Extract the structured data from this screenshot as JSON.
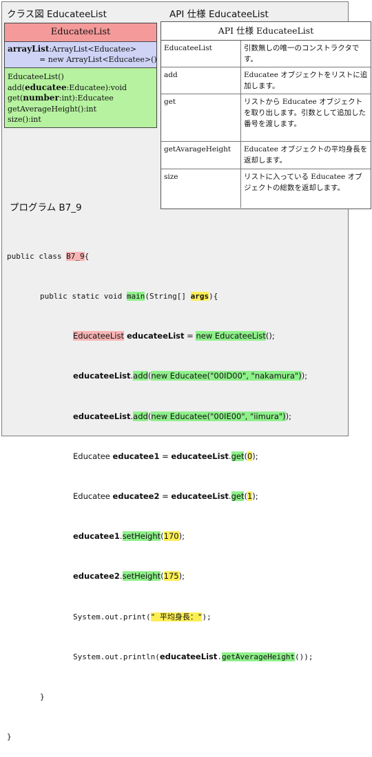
{
  "headings": {
    "class_diagram": "クラス図 EducateeList",
    "api_spec": "API 仕様 EducateeList",
    "program": "プログラム B7_9"
  },
  "uml": {
    "class_name": "EducateeList",
    "attr_name": "arrayList",
    "attr_type": ":ArrayList<Educatee>",
    "attr_init": "= new ArrayList<Educatee>()",
    "ops": [
      {
        "pre": "EducateeList()",
        "bold": "",
        "post": ""
      },
      {
        "pre": "add(",
        "bold": "educatee",
        "post": ":Educatee):void"
      },
      {
        "pre": "get(",
        "bold": "number",
        "post": ":int):Educatee"
      },
      {
        "pre": "getAverageHeight():int",
        "bold": "",
        "post": ""
      },
      {
        "pre": "size():int",
        "bold": "",
        "post": ""
      }
    ]
  },
  "api": {
    "caption": "API 仕様 EducateeList",
    "rows": [
      {
        "method": "EducateeList",
        "desc": "引数無しの唯一のコンストラクタです。"
      },
      {
        "method": "add",
        "desc": "Educatee オブジェクトをリストに追加します。"
      },
      {
        "method": "get",
        "desc": "リストから Educatee オブジェクトを取り出します。引数として追加した番号を渡します。"
      },
      {
        "method": "getAvarageHeight",
        "desc": "Educatee オブジェクトの平均身長を返却します。"
      },
      {
        "method": "size",
        "desc": "リストに入っている Educatee オブジェクトの総数を返却します。"
      }
    ]
  },
  "code": {
    "l1a": "public class ",
    "l1b": "B7_9",
    "l1c": "{",
    "l2a": "public static void ",
    "l2b": "main",
    "l2c": "(String[] ",
    "l2d": "args",
    "l2e": "){",
    "l3a": "EducateeList",
    "l3b": " educateeList",
    "l3c": " = ",
    "l3d": "new EducateeList",
    "l3e": "();",
    "l4a": "educateeList",
    "l4b": ".",
    "l4c": "add",
    "l4d": "(",
    "l4e": "new Educatee(\"00ID00\", \"nakamura\")",
    "l4f": ");",
    "l5a": "educateeList",
    "l5b": ".",
    "l5c": "add",
    "l5d": "(",
    "l5e": "new Educatee(\"00IE00\", \"iimura\")",
    "l5f": ");",
    "l6a": "Educatee ",
    "l6b": "educatee1",
    "l6c": " = ",
    "l6d": "educateeList",
    "l6e": ".",
    "l6f": "get",
    "l6g": "(",
    "l6h": "0",
    "l6i": ");",
    "l7a": "Educatee ",
    "l7b": "educatee2",
    "l7c": " = ",
    "l7d": "educateeList",
    "l7e": ".",
    "l7f": "get",
    "l7g": "(",
    "l7h": "1",
    "l7i": ");",
    "l8a": "educatee1",
    "l8b": ".",
    "l8c": "setHeight",
    "l8d": "(",
    "l8e": "170",
    "l8f": ");",
    "l9a": "educatee2",
    "l9b": ".",
    "l9c": "setHeight",
    "l9d": "(",
    "l9e": "175",
    "l9f": ");",
    "l10a": "System.out.print(",
    "l10b": "\" 平均身長：\"",
    "l10c": ");",
    "l11a": "System.out.println(",
    "l11b": "educateeList",
    "l11c": ".",
    "l11d": "getAverageHeight",
    "l11e": "());",
    "l12": "}",
    "l13": "}"
  }
}
